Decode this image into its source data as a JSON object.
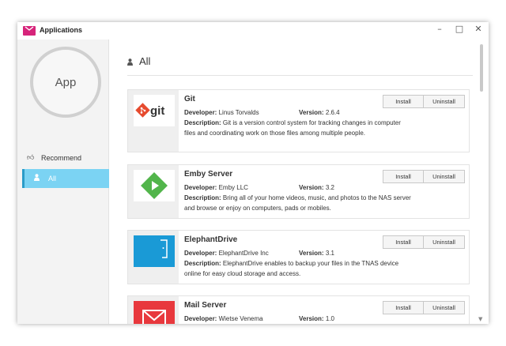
{
  "window": {
    "title": "Applications",
    "minimize": "–",
    "maximize": "□",
    "close": "✕"
  },
  "sidebar": {
    "avatar_text": "App",
    "items": [
      {
        "label": "Recommend",
        "icon": "thumbs-up-icon",
        "active": false
      },
      {
        "label": "All",
        "icon": "person-icon",
        "active": true
      }
    ]
  },
  "main": {
    "heading": "All",
    "heading_icon": "person-icon",
    "labels": {
      "developer": "Developer:",
      "version": "Version:",
      "description": "Description:",
      "install": "Install",
      "uninstall": "Uninstall"
    },
    "apps": [
      {
        "name": "Git",
        "developer": "Linus Torvalds",
        "version": "2.6.4",
        "description": "Git is a version control system for tracking changes in computer files and coordinating work on those files among multiple people.",
        "logo_text": "git"
      },
      {
        "name": "Emby Server",
        "developer": "Emby LLC",
        "version": "3.2",
        "description": "Bring all of your home videos, music, and photos to the NAS server and browse or enjoy on computers, pads or mobiles."
      },
      {
        "name": "ElephantDrive",
        "developer": "ElephantDrive Inc",
        "version": "3.1",
        "description": "ElephantDrive enables to backup your files in the TNAS device online for easy cloud storage and access."
      },
      {
        "name": "Mail Server",
        "developer": "Wietse Venema",
        "version": "1.0",
        "description": ""
      }
    ]
  },
  "colors": {
    "accent": "#7bd3f3",
    "brand": "#d6247a",
    "git": "#e64a2e",
    "emby": "#52b54b",
    "elephant": "#1a9ad6",
    "mail": "#e8383d"
  }
}
